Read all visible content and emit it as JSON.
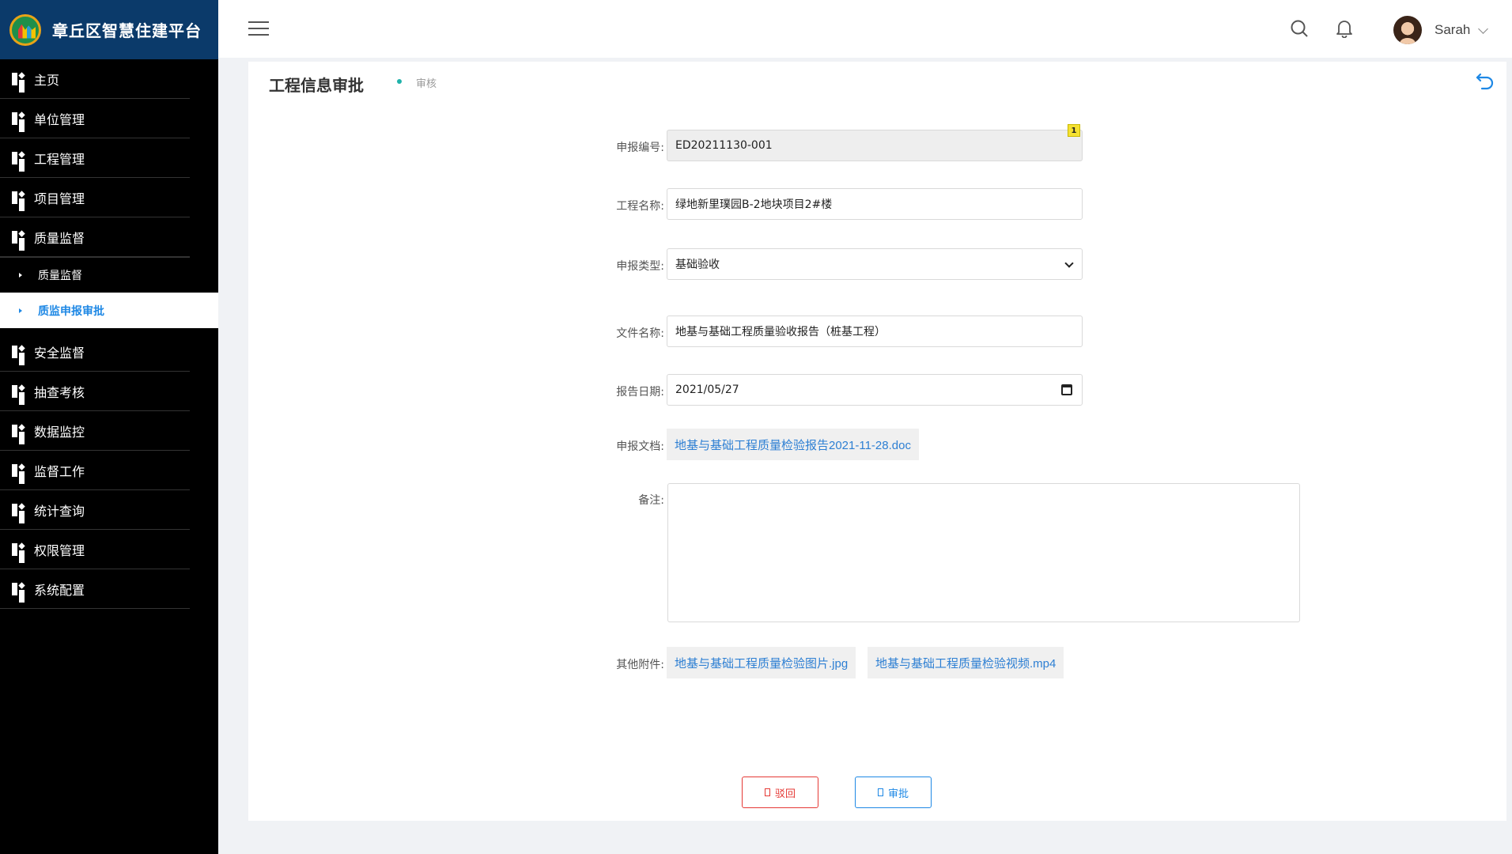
{
  "app": {
    "title": "章丘区智慧住建平台"
  },
  "sidebar": {
    "items_top": [
      {
        "label": "主页"
      },
      {
        "label": "单位管理"
      },
      {
        "label": "工程管理"
      },
      {
        "label": "项目管理"
      },
      {
        "label": "质量监督"
      }
    ],
    "sub_items": [
      {
        "label": "质量监督",
        "active": false
      },
      {
        "label": "质监申报审批",
        "active": true
      }
    ],
    "items_bottom": [
      {
        "label": "安全监督"
      },
      {
        "label": "抽查考核"
      },
      {
        "label": "数据监控"
      },
      {
        "label": "监督工作"
      },
      {
        "label": "统计查询"
      },
      {
        "label": "权限管理"
      },
      {
        "label": "系统配置"
      }
    ]
  },
  "header": {
    "user_name": "Sarah"
  },
  "page": {
    "title": "工程信息审批",
    "breadcrumb": "审核"
  },
  "form": {
    "report_no": {
      "label": "申报编号:",
      "value": "ED20211130-001",
      "badge": "1"
    },
    "project_name": {
      "label": "工程名称:",
      "value": "绿地新里璞园B-2地块项目2#楼"
    },
    "report_type": {
      "label": "申报类型:",
      "value": "基础验收"
    },
    "file_name": {
      "label": "文件名称:",
      "value": "地基与基础工程质量验收报告（桩基工程）"
    },
    "report_date": {
      "label": "报告日期:",
      "value": "2021/05/27"
    },
    "report_doc": {
      "label": "申报文档:",
      "value": "地基与基础工程质量检验报告2021-11-28.doc"
    },
    "remark": {
      "label": "备注:",
      "value": ""
    },
    "attachments": {
      "label": "其他附件:",
      "files": [
        "地基与基础工程质量检验图片.jpg",
        "地基与基础工程质量检验视频.mp4"
      ]
    }
  },
  "actions": {
    "reject_label": "驳回",
    "approve_label": "审批"
  },
  "colors": {
    "sidebar_bg": "#000000",
    "brand_bg": "#0b3a6a",
    "accent": "#1e88e5",
    "danger": "#e53935",
    "link": "#2d7fd3"
  }
}
